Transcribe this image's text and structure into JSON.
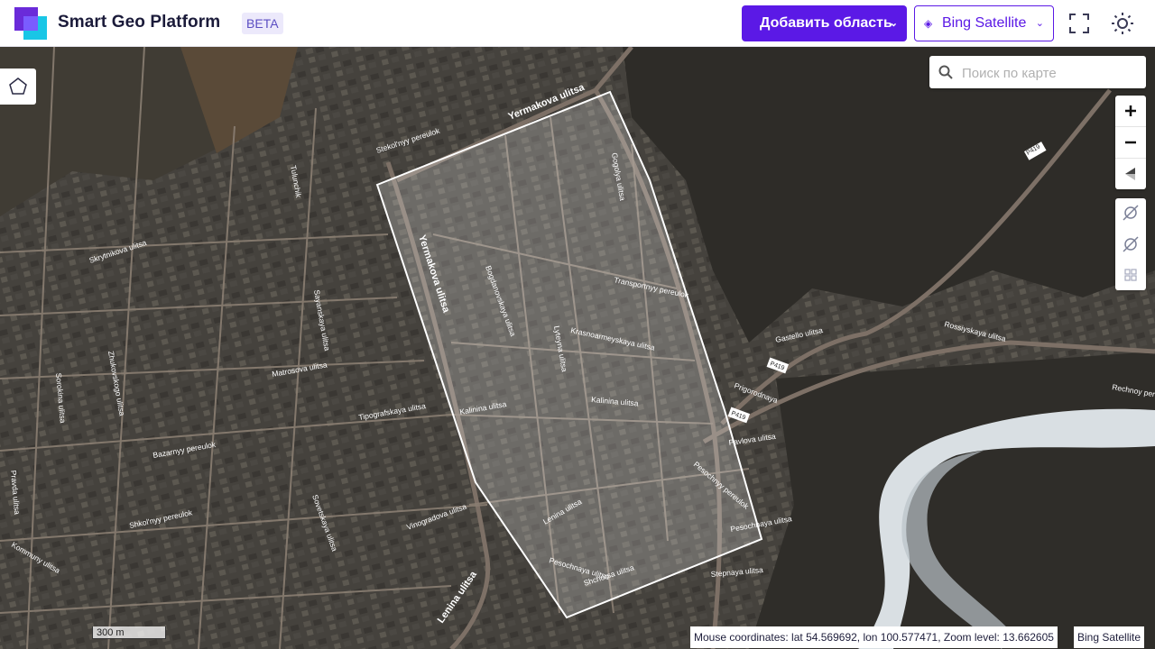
{
  "header": {
    "app_title": "Smart Geo Platform",
    "badge": "BETA",
    "add_area_button": "Добавить область",
    "layer_select_value": "Bing Satellite"
  },
  "search": {
    "placeholder": "Поиск по карте"
  },
  "map": {
    "scale_label": "300 m",
    "coordinates_text": "Mouse coordinates: lat 54.569692, lon 100.577471, Zoom level: 13.662605",
    "attribution": "Bing Satellite",
    "road_labels": {
      "yermakova_top": "Yermakova ulitsa",
      "yermakova_vertical": "Yermakova ulitsa",
      "stekolnyy": "Stekol'nyy pereulok",
      "tulunchik": "Tulunchik",
      "bogdanovskaya": "Bogdanovskaya ulitsa",
      "kalinina_1": "Kalinina ulitsa",
      "kalinina_2": "Kalinina ulitsa",
      "transportnyy": "Transportnyy pereulok",
      "krasnoarmeyskaya": "Krasnoarmeyskaya ulitsa",
      "gastello": "Gastello ulitsa",
      "rossiyskaya": "Rossiyskaya ulitsa",
      "prigorodnaya": "Prigorodnaya",
      "pavlova": "Pavlova ulitsa",
      "pesochnyy": "Pesochnyy pereulok",
      "pesochnaya_1": "Pesochnaya ulitsa",
      "pesochnaya_2": "Pesochnaya ulitsa",
      "lenina": "Lenina ulitsa",
      "lenina_2": "Lenina ulitsa",
      "shchorsa": "Shchorsa ulitsa",
      "skrytnikova": "Skrytnikova ulitsa",
      "zhukovskogo": "Zhukovskogo ulitsa",
      "sorokina": "Sorokina ulitsa",
      "kommuny": "Kommuny ulitsa",
      "tipografskaya": "Tipografskaya ulitsa",
      "vinogradova": "Vinogradova ulitsa",
      "stepnaya": "Stepnaya ulitsa",
      "rechnoy": "Rechnoy pereulok",
      "sayanskaya": "Sayanskaya ulitsa",
      "matrosova": "Matrosova ulitsa",
      "bazarnyy": "Bazarnyy pereulok",
      "shkolnyy": "Shkol'nyy pereulok",
      "pravda": "Pravda ulitsa",
      "lyteyna": "Lyteyna ulitsa",
      "gogolya": "Gogolya ulitsa",
      "sovetskaya": "Sovetskaya ulitsa",
      "r419_1": "P419",
      "r419_2": "P419",
      "r419_3": "P419"
    }
  }
}
